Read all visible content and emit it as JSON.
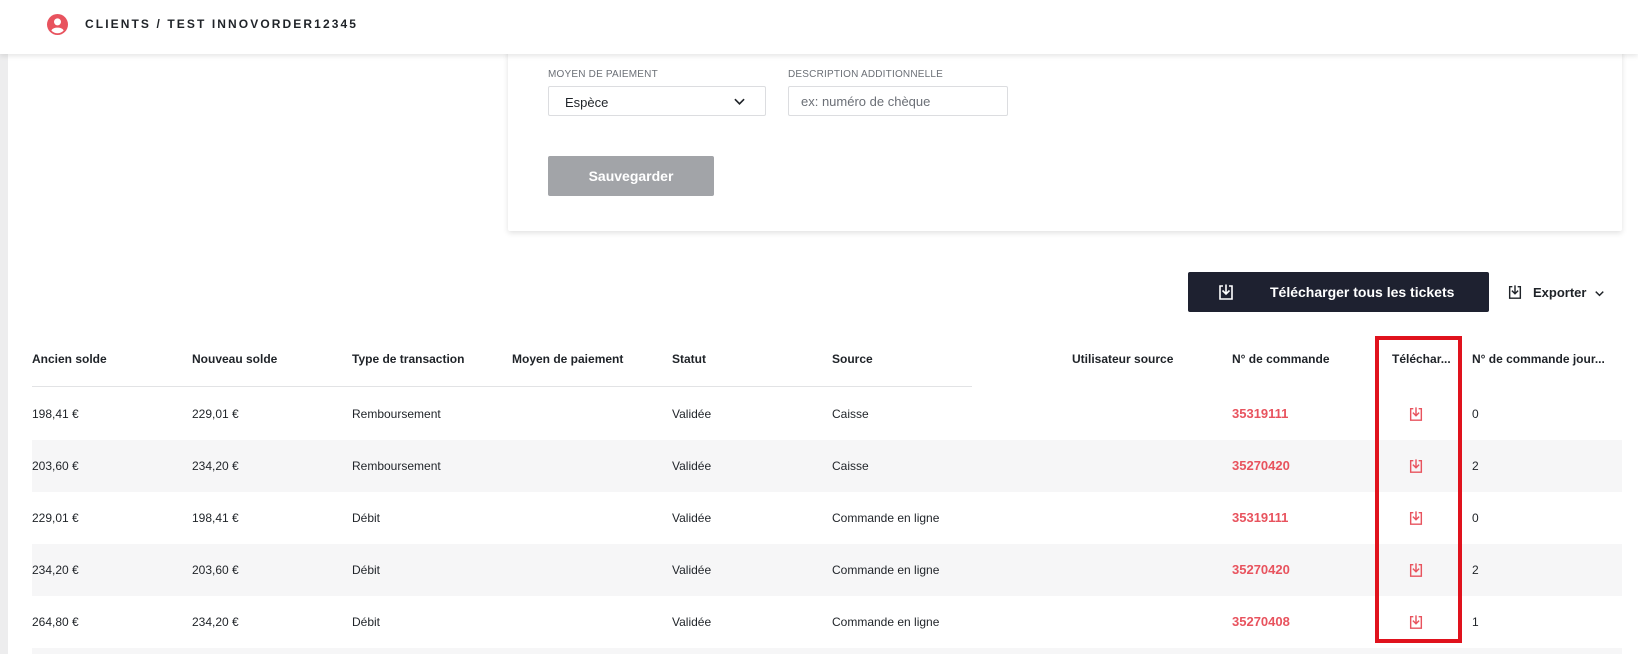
{
  "header": {
    "breadcrumb": "CLIENTS / TEST INNOVORDER12345"
  },
  "form": {
    "payment_method_label": "MOYEN DE PAIEMENT",
    "payment_method_value": "Espèce",
    "description_label": "DESCRIPTION ADDITIONNELLE",
    "description_placeholder": "ex: numéro de chèque",
    "save_label": "Sauvegarder"
  },
  "actions": {
    "download_all_label": "Télécharger tous les tickets",
    "export_label": "Exporter"
  },
  "table": {
    "columns": [
      "Ancien solde",
      "Nouveau solde",
      "Type de transaction",
      "Moyen de paiement",
      "Statut",
      "Source",
      "Utilisateur source",
      "N° de commande",
      "Téléchar...",
      "N° de commande jour..."
    ],
    "rows": [
      {
        "old_balance": "198,41 €",
        "new_balance": "229,01 €",
        "type": "Remboursement",
        "payment": "",
        "status": "Validée",
        "source": "Caisse",
        "user": "",
        "order": "35319111",
        "day_order": "0"
      },
      {
        "old_balance": "203,60 €",
        "new_balance": "234,20 €",
        "type": "Remboursement",
        "payment": "",
        "status": "Validée",
        "source": "Caisse",
        "user": "",
        "order": "35270420",
        "day_order": "2"
      },
      {
        "old_balance": "229,01 €",
        "new_balance": "198,41 €",
        "type": "Débit",
        "payment": "",
        "status": "Validée",
        "source": "Commande en ligne",
        "user": "",
        "order": "35319111",
        "day_order": "0"
      },
      {
        "old_balance": "234,20 €",
        "new_balance": "203,60 €",
        "type": "Débit",
        "payment": "",
        "status": "Validée",
        "source": "Commande en ligne",
        "user": "",
        "order": "35270420",
        "day_order": "2"
      },
      {
        "old_balance": "264,80 €",
        "new_balance": "234,20 €",
        "type": "Débit",
        "payment": "",
        "status": "Validée",
        "source": "Commande en ligne",
        "user": "",
        "order": "35270408",
        "day_order": "1"
      }
    ]
  },
  "colors": {
    "accent": "#e8535e",
    "dark_button": "#1e2130",
    "disabled_button": "#a2a4a8",
    "highlight_box": "#e0121d"
  },
  "icons": {
    "header": "user-circle-icon",
    "download_all": "download-icon",
    "export": "download-icon",
    "row_download": "download-icon"
  }
}
